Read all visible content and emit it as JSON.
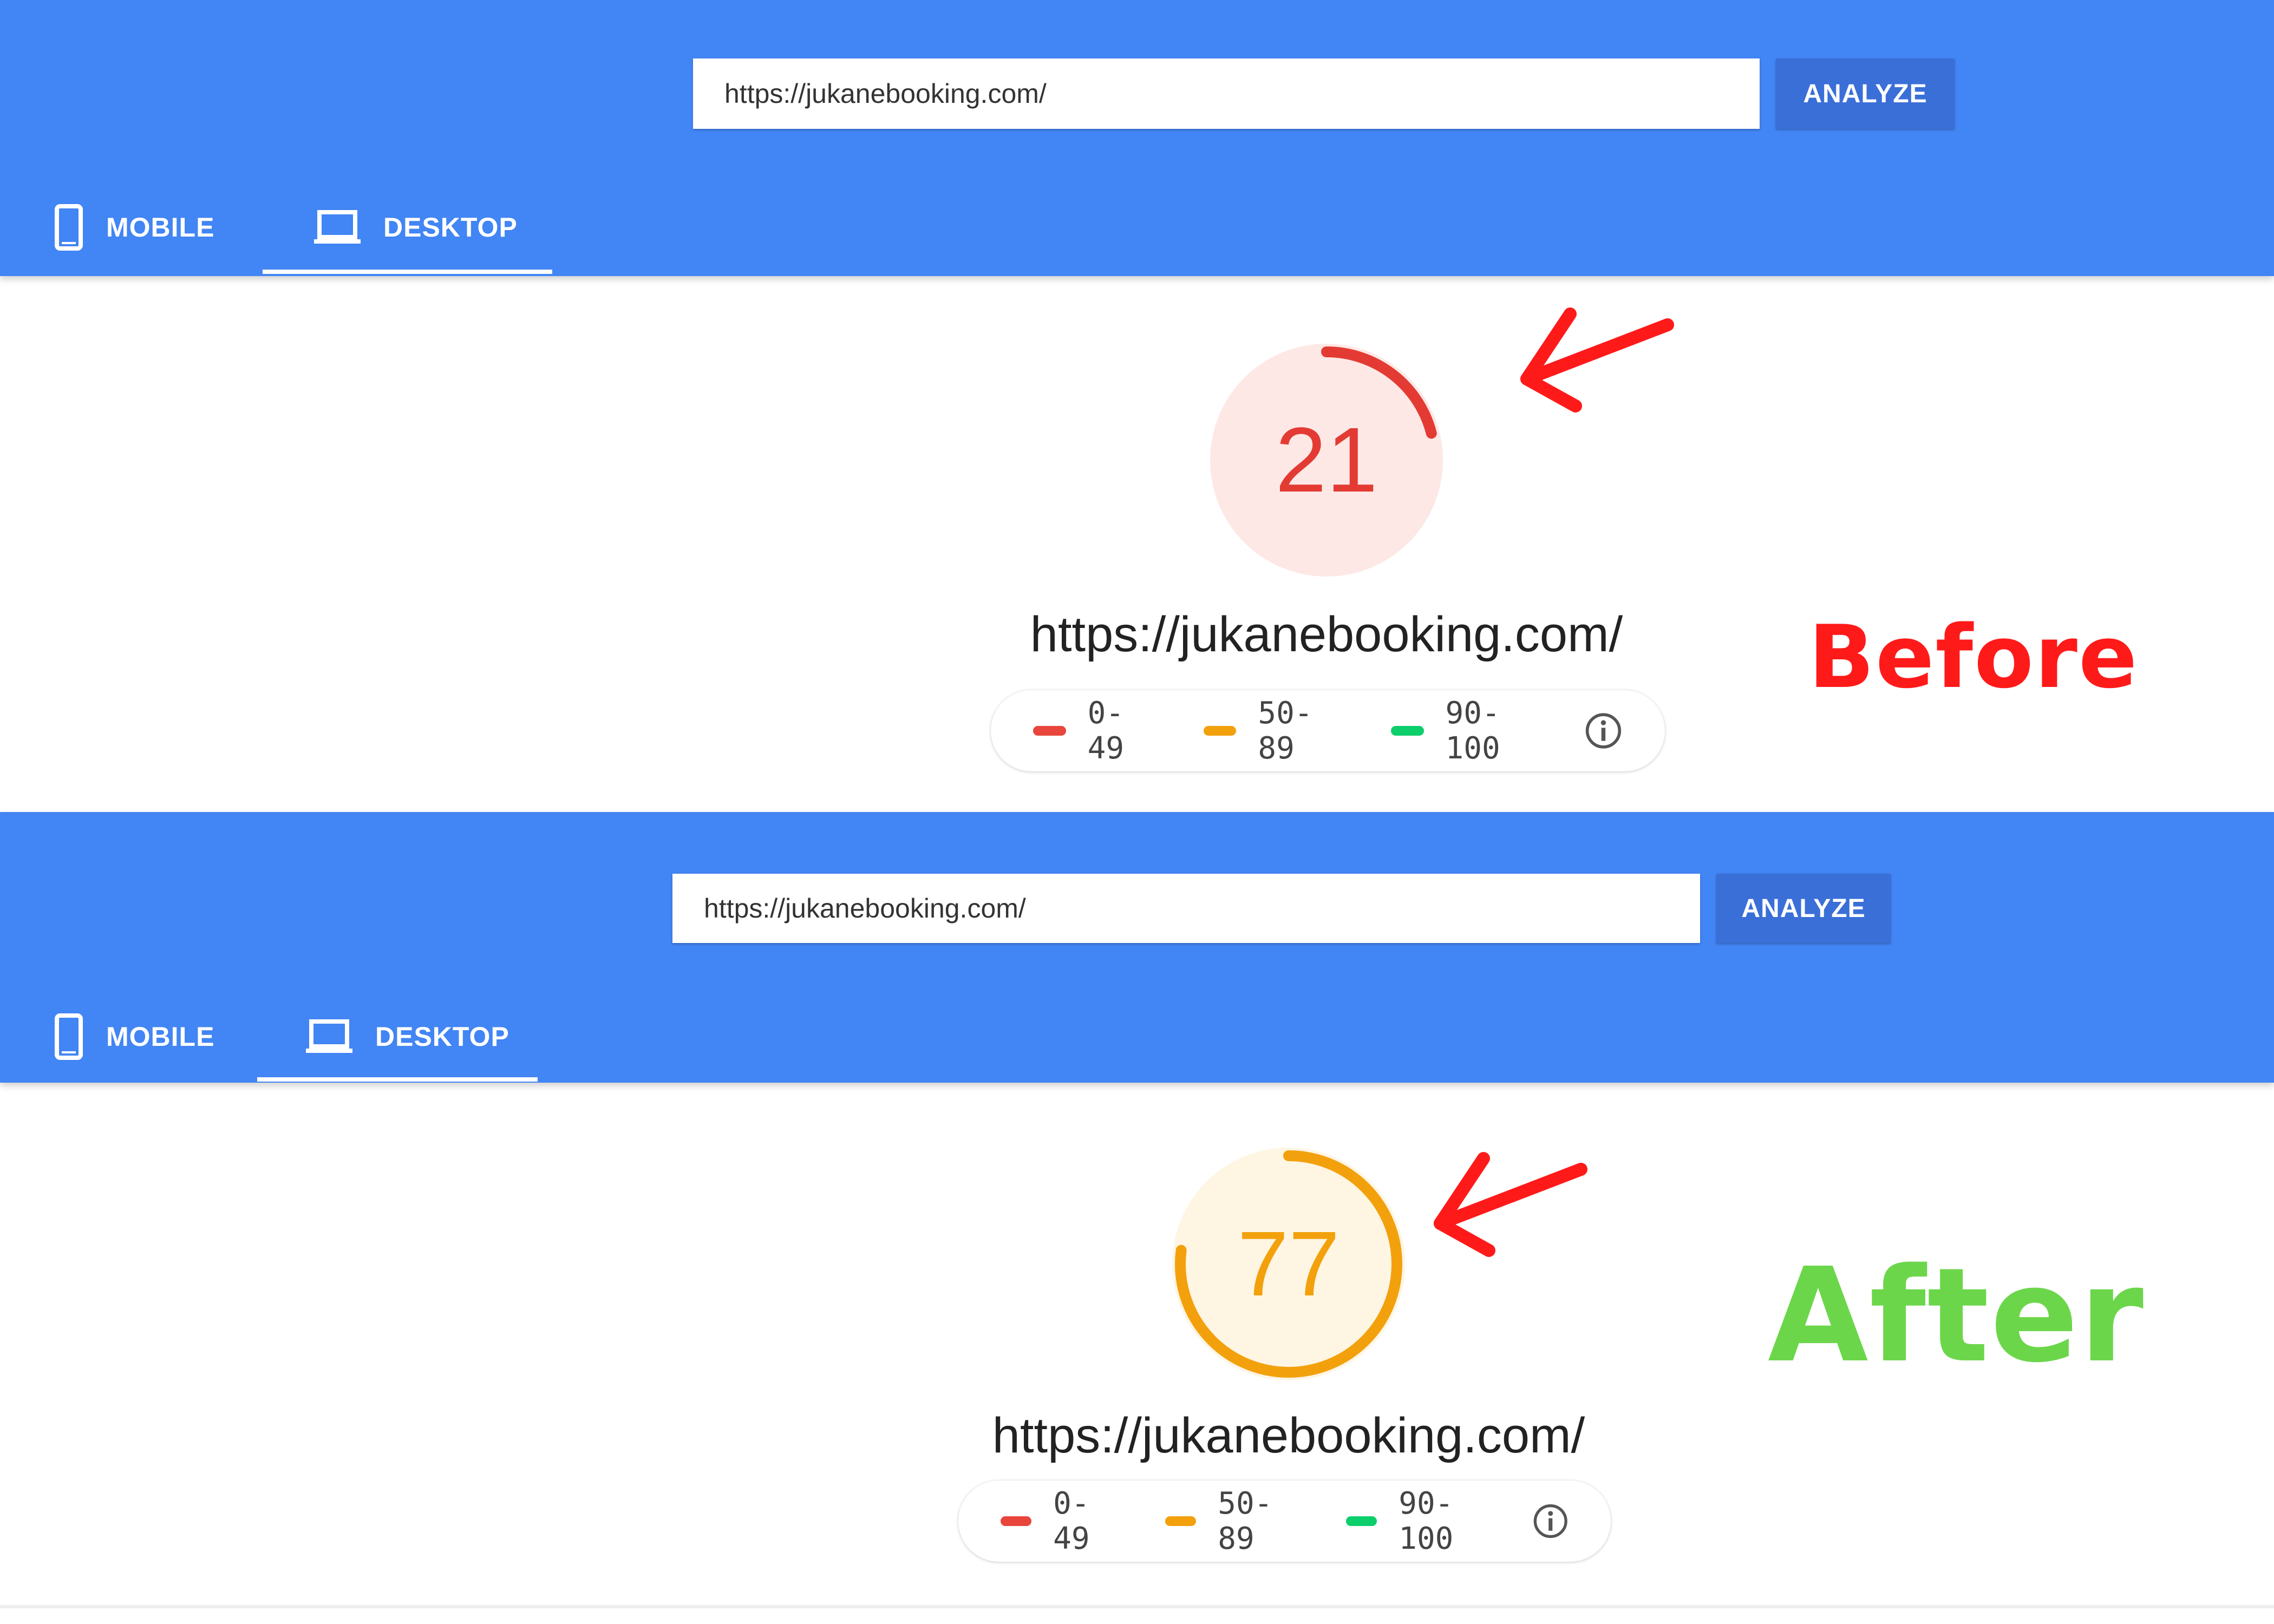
{
  "panels": [
    {
      "label": "Before",
      "search": {
        "value": "https://jukanebooking.com/"
      },
      "analyze_label": "ANALYZE",
      "tabs": {
        "mobile": "MOBILE",
        "desktop": "DESKTOP"
      },
      "score": "21",
      "score_fraction": 0.21,
      "score_color": "#e33b33",
      "gauge_bg": "#fde8e6",
      "site_url": "https://jukanebooking.com/",
      "legend": [
        {
          "label": "0-49",
          "color": "#e8453c"
        },
        {
          "label": "50-89",
          "color": "#f2a10c"
        },
        {
          "label": "90-100",
          "color": "#0cce6b"
        }
      ]
    },
    {
      "label": "After",
      "search": {
        "value": "https://jukanebooking.com/"
      },
      "analyze_label": "ANALYZE",
      "tabs": {
        "mobile": "MOBILE",
        "desktop": "DESKTOP"
      },
      "score": "77",
      "score_fraction": 0.77,
      "score_color": "#f2a10c",
      "gauge_bg": "#fff5e3",
      "site_url": "https://jukanebooking.com/",
      "legend": [
        {
          "label": "0-49",
          "color": "#e8453c"
        },
        {
          "label": "50-89",
          "color": "#f2a10c"
        },
        {
          "label": "90-100",
          "color": "#0cce6b"
        }
      ]
    }
  ],
  "colors": {
    "header": "#4285f4",
    "analyze_button": "#3a6fd8",
    "arrow": "#ff1a1a",
    "before_label": "#ff1a1a",
    "after_label": "#6cd64b"
  },
  "icons": {
    "mobile_tab": "phone-icon",
    "desktop_tab": "laptop-icon",
    "info": "info-icon",
    "pointer": "arrow-icon"
  }
}
